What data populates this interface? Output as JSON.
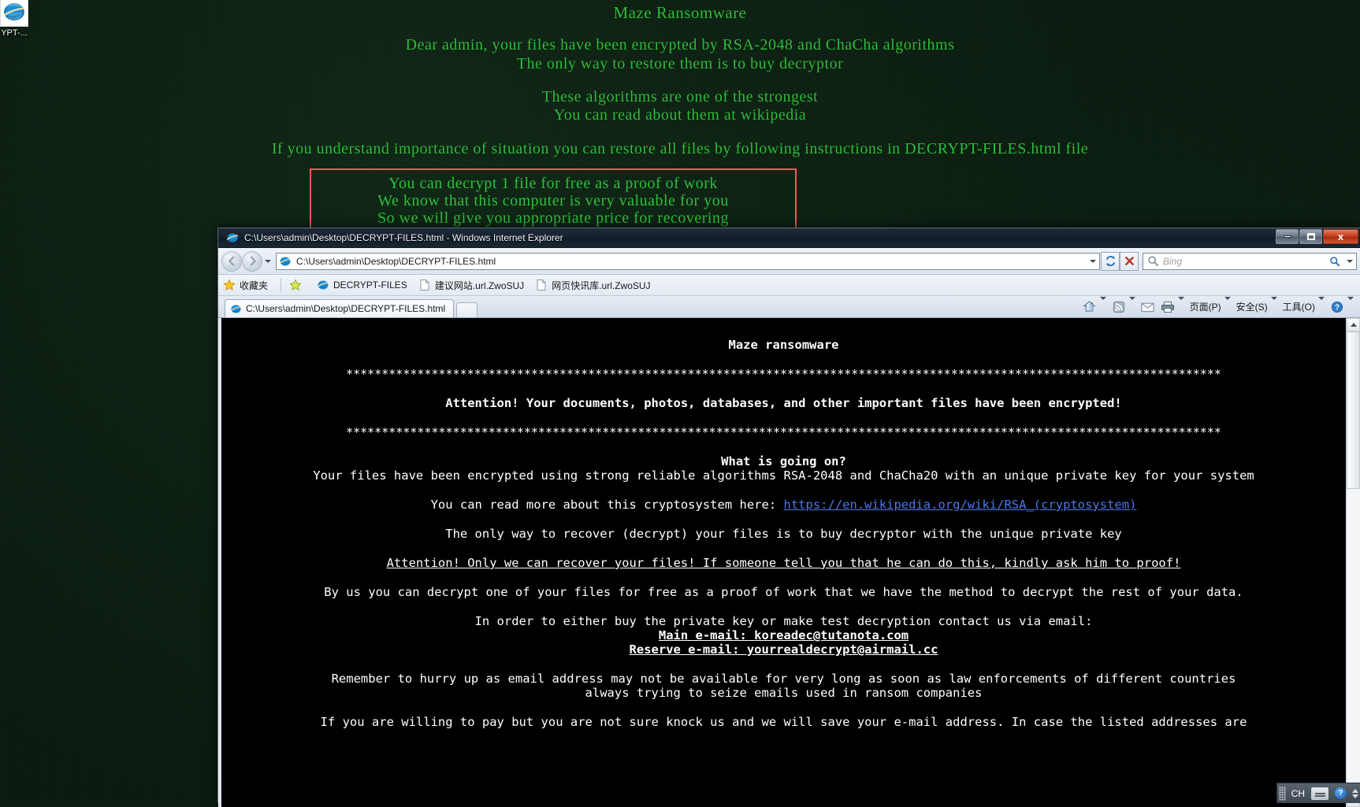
{
  "desktop": {
    "icon_label": "YPT-...",
    "icon_name": "internet-explorer-shortcut",
    "wallpaper": {
      "title": "Maze Ransomware",
      "line1": "Dear admin, your files have been encrypted by RSA-2048 and ChaCha algorithms",
      "line2": "The only way to restore them is to buy decryptor",
      "line3": "These algorithms are one of the strongest",
      "line4": "You can read about them at wikipedia",
      "line5": "If you understand importance of situation you can restore all files by following instructions in DECRYPT-FILES.html file",
      "box_line1": "You can decrypt 1 file for free as a proof of work",
      "box_line2": "We know that this computer is very valuable for you",
      "box_line3": "So we will give you appropriate price for recovering",
      "text_color": "#2fbf3a",
      "box_border_color": "#ef5a5a",
      "background_color": "#09180d"
    }
  },
  "window": {
    "title": "C:\\Users\\admin\\Desktop\\DECRYPT-FILES.html - Windows Internet Explorer",
    "minimize_label": "",
    "maximize_label": "",
    "close_label": "x"
  },
  "navbar": {
    "back_tooltip": "Back",
    "forward_tooltip": "Forward",
    "address_value": "C:\\Users\\admin\\Desktop\\DECRYPT-FILES.html",
    "refresh_name": "refresh-icon",
    "stop_name": "stop-icon",
    "search_placeholder": "Bing"
  },
  "favorites": {
    "label": "收藏夹",
    "items": [
      {
        "label": "DECRYPT-FILES",
        "icon": "internet-explorer-icon"
      },
      {
        "label": "建议网站.url.ZwoSUJ",
        "icon": "page-icon"
      },
      {
        "label": "网页快讯库.url.ZwoSUJ",
        "icon": "page-icon"
      }
    ]
  },
  "tabs": [
    {
      "label": "C:\\Users\\admin\\Desktop\\DECRYPT-FILES.html",
      "active": true
    }
  ],
  "command_bar": {
    "home": "home-icon",
    "feeds": "rss-feed-icon",
    "mail": "mail-icon",
    "print": "printer-icon",
    "page_menu": "页面(P)",
    "safety_menu": "安全(S)",
    "tools_menu": "工具(O)",
    "help": "help-icon"
  },
  "document": {
    "title": "Maze ransomware",
    "stars": "***************************************************************************************************************************",
    "attention": "Attention! Your documents, photos, databases, and other important files have been encrypted!",
    "heading_what": "What is going on?",
    "what_body": "Your files have been encrypted using strong reliable algorithms RSA-2048 and ChaCha20 with an unique private key for your system",
    "read_more_prefix": "You can read more about this cryptosystem here: ",
    "wiki_link": "https://en.wikipedia.org/wiki/RSA_(cryptosystem)",
    "only_way": "The only way to recover (decrypt) your files is to buy decryptor with the unique private key",
    "attention2": "Attention! Only we can recover your files! If someone tell you that he can do this, kindly ask him to proof!",
    "proof_of_work": "By us you can decrypt one of your files for free as a proof of work that we have the method to decrypt the rest of your data.",
    "contact_intro": "In order to either buy the private key or make test decryption contact us via email:",
    "main_email": "Main e-mail: koreadec@tutanota.com",
    "reserve_email": "Reserve e-mail: yourrealdecrypt@airmail.cc",
    "hurry1": "Remember to hurry up as email address may not be available for very long as soon as law enforcements of different countries",
    "hurry2": "always trying to seize emails used in ransom companies",
    "willing": "If you are willing to pay but you are not sure knock us and we will save your e-mail address. In case the listed addresses are",
    "link_color": "#4b78e8",
    "text_color": "#ffffff",
    "background_color": "#000000"
  },
  "ime": {
    "language": "CH",
    "keyboard": "keyboard-icon",
    "help": "?"
  }
}
